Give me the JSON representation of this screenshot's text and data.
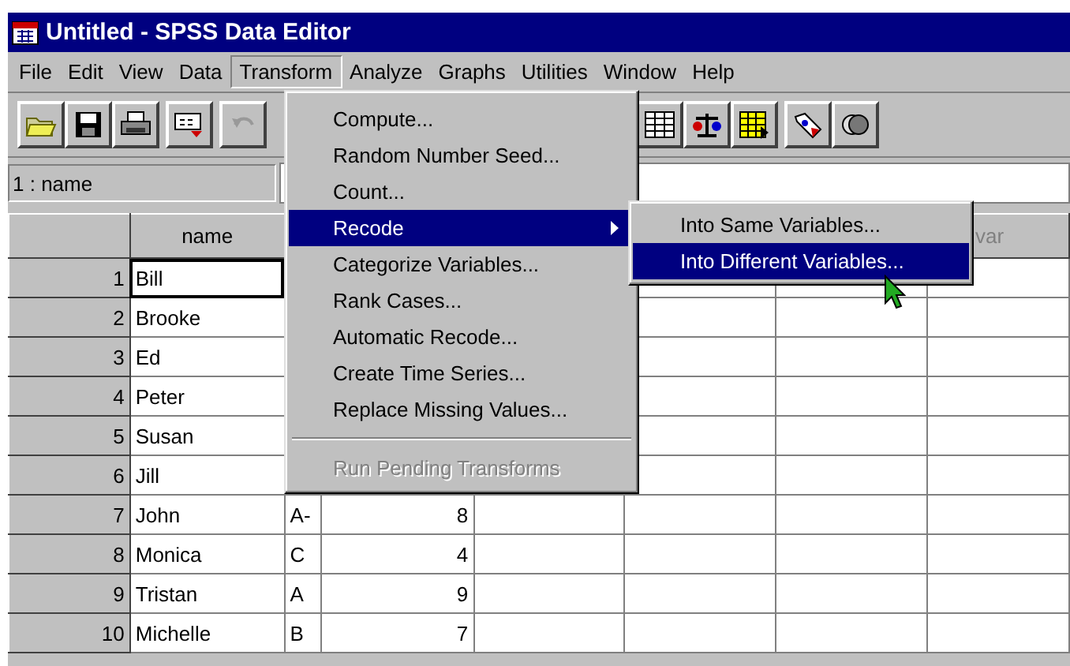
{
  "window": {
    "title": "Untitled - SPSS Data Editor"
  },
  "menu_bar": [
    {
      "label": "File",
      "selected": false
    },
    {
      "label": "Edit",
      "selected": false
    },
    {
      "label": "View",
      "selected": false
    },
    {
      "label": "Data",
      "selected": false
    },
    {
      "label": "Transform",
      "selected": true
    },
    {
      "label": "Analyze",
      "selected": false
    },
    {
      "label": "Graphs",
      "selected": false
    },
    {
      "label": "Utilities",
      "selected": false
    },
    {
      "label": "Window",
      "selected": false
    },
    {
      "label": "Help",
      "selected": false
    }
  ],
  "cell_reference": "1 : name",
  "grid": {
    "header_name": "name",
    "header_last": "var",
    "rows": [
      {
        "number": "1",
        "name": "Bill",
        "selected": true
      },
      {
        "number": "2",
        "name": "Brooke",
        "selected": false
      },
      {
        "number": "3",
        "name": "Ed",
        "selected": false
      },
      {
        "number": "4",
        "name": "Peter",
        "selected": false
      },
      {
        "number": "5",
        "name": "Susan",
        "selected": false
      },
      {
        "number": "6",
        "name": "Jill",
        "selected": false
      },
      {
        "number": "7",
        "name": "John",
        "grade": "A-",
        "score": "8",
        "selected": false
      },
      {
        "number": "8",
        "name": "Monica",
        "grade": "C",
        "score": "4",
        "selected": false
      },
      {
        "number": "9",
        "name": "Tristan",
        "grade": "A",
        "score": "9",
        "selected": false
      },
      {
        "number": "10",
        "name": "Michelle",
        "grade": "B",
        "score": "7",
        "selected": false
      }
    ]
  },
  "transform_menu": [
    {
      "kind": "item",
      "label": "Compute...",
      "selected": false,
      "disabled": false
    },
    {
      "kind": "item",
      "label": "Random Number Seed...",
      "selected": false,
      "disabled": false
    },
    {
      "kind": "item",
      "label": "Count...",
      "selected": false,
      "disabled": false
    },
    {
      "kind": "submenu",
      "label": "Recode",
      "selected": true,
      "disabled": false
    },
    {
      "kind": "item",
      "label": "Categorize Variables...",
      "selected": false,
      "disabled": false
    },
    {
      "kind": "item",
      "label": "Rank Cases...",
      "selected": false,
      "disabled": false
    },
    {
      "kind": "item",
      "label": "Automatic Recode...",
      "selected": false,
      "disabled": false
    },
    {
      "kind": "item",
      "label": "Create Time Series...",
      "selected": false,
      "disabled": false
    },
    {
      "kind": "item",
      "label": "Replace Missing Values...",
      "selected": false,
      "disabled": false
    },
    {
      "kind": "separator"
    },
    {
      "kind": "item",
      "label": "Run Pending Transforms",
      "selected": false,
      "disabled": true
    }
  ],
  "recode_submenu": [
    {
      "label": "Into Same Variables...",
      "selected": false
    },
    {
      "label": "Into Different Variables...",
      "selected": true
    }
  ]
}
